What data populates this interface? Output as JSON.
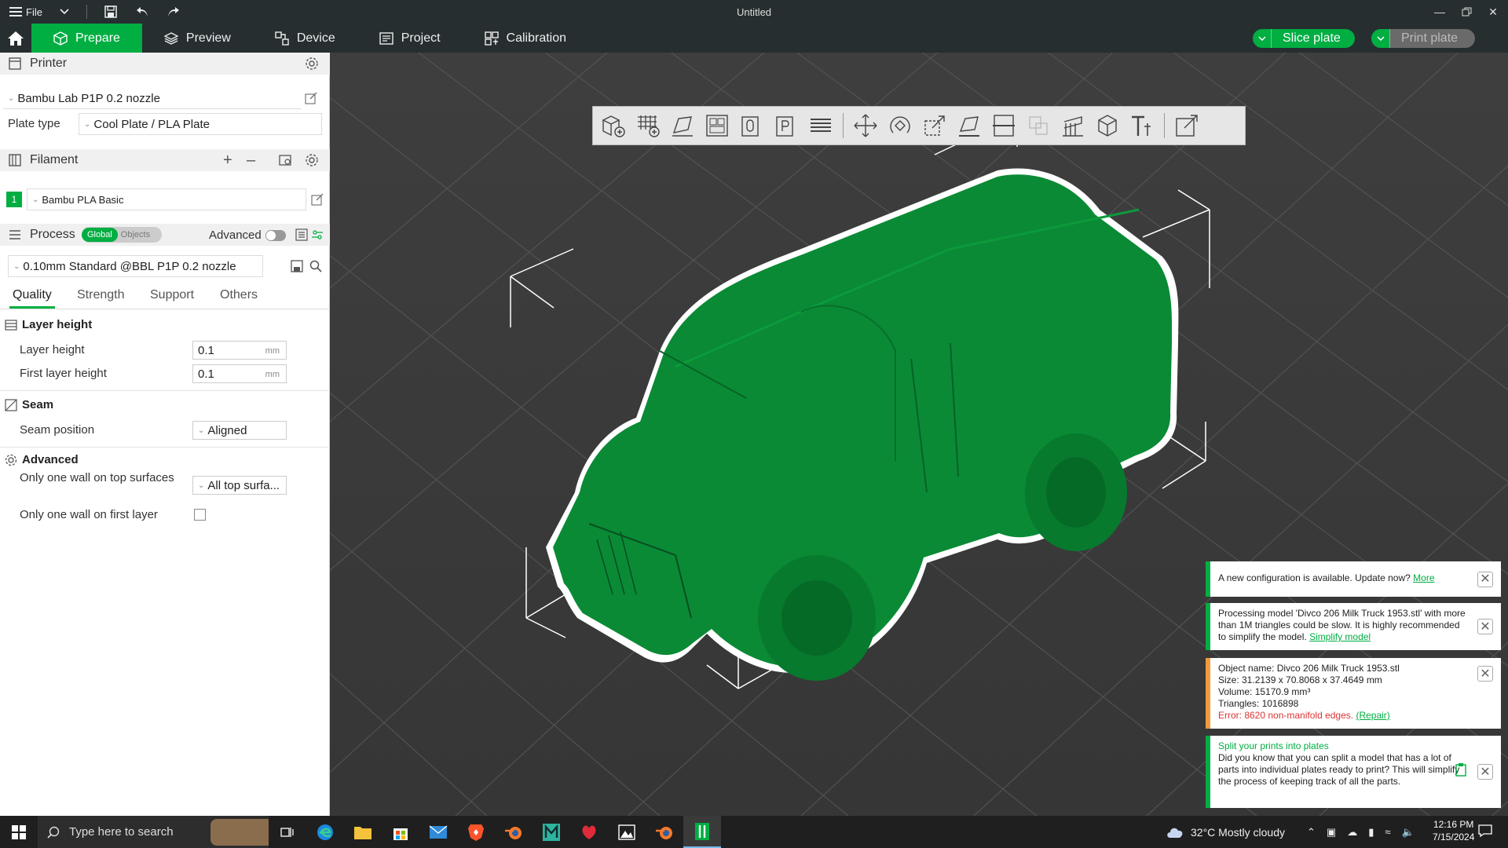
{
  "window": {
    "title": "Untitled",
    "file_menu": "File"
  },
  "tabs": [
    {
      "label": "Prepare",
      "icon": "cube-icon"
    },
    {
      "label": "Preview",
      "icon": "layers-icon"
    },
    {
      "label": "Device",
      "icon": "device-icon"
    },
    {
      "label": "Project",
      "icon": "project-icon"
    },
    {
      "label": "Calibration",
      "icon": "calibration-icon"
    }
  ],
  "actions": {
    "slice": "Slice plate",
    "print": "Print plate"
  },
  "printer": {
    "section_label": "Printer",
    "name": "Bambu Lab P1P 0.2 nozzle",
    "plate_type_label": "Plate type",
    "plate_type": "Cool Plate / PLA Plate"
  },
  "filament": {
    "section_label": "Filament",
    "slot_number": "1",
    "name": "Bambu PLA Basic",
    "slot_color": "#00ae42"
  },
  "process": {
    "section_label": "Process",
    "toggle_global": "Global",
    "toggle_objects": "Objects",
    "advanced_label": "Advanced",
    "profile": "0.10mm Standard @BBL P1P 0.2 nozzle",
    "subtabs": [
      "Quality",
      "Strength",
      "Support",
      "Others"
    ]
  },
  "settings": {
    "layer_height_group": "Layer height",
    "layer_height_label": "Layer height",
    "layer_height_value": "0.1",
    "first_layer_height_label": "First layer height",
    "first_layer_height_value": "0.1",
    "unit_mm": "mm",
    "seam_group": "Seam",
    "seam_position_label": "Seam position",
    "seam_position_value": "Aligned",
    "advanced_group": "Advanced",
    "one_wall_top_label": "Only one wall on top surfaces",
    "one_wall_top_value": "All top surfa...",
    "one_wall_first_label": "Only one wall on first layer"
  },
  "notifications": {
    "config": {
      "text": "A new configuration is available. Update now?",
      "link": "More"
    },
    "processing": {
      "text": "Processing model 'Divco 206 Milk Truck 1953.stl' with more than 1M triangles could be slow. It is highly recommended to simplify the model.",
      "link": "Simplify model"
    },
    "object": {
      "name": "Object name: Divco 206 Milk Truck 1953.stl",
      "size": "Size: 31.2139 x 70.8068 x 37.4649 mm",
      "volume": "Volume: 15170.9 mm³",
      "triangles": "Triangles: 1016898",
      "error": "Error: 8620 non-manifold edges.",
      "repair": "(Repair)"
    },
    "tip": {
      "title": "Split your prints into plates",
      "text": "Did you know that you can split a model that has a lot of parts into individual plates ready to print? This will simplify the process of keeping track of all the parts."
    }
  },
  "taskbar": {
    "search_placeholder": "Type here to search",
    "weather": "32°C  Mostly cloudy",
    "time": "12:16 PM",
    "date": "7/15/2024"
  },
  "colors": {
    "accent": "#00ae42",
    "model_green": "#0a8a35",
    "warning_orange": "#f09a3e",
    "error_red": "#d33333"
  }
}
